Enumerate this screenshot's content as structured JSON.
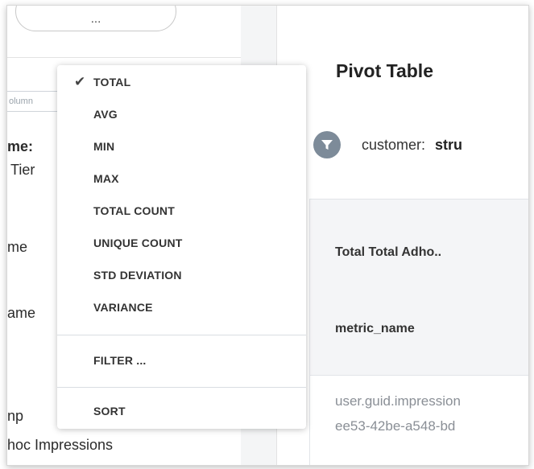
{
  "left_panel": {
    "top_pill_text": "...",
    "search_placeholder": "olumn",
    "texts": [
      "me:",
      "Tier",
      "me",
      "ame",
      "np",
      "hoc Impressions"
    ]
  },
  "right_panel": {
    "title": "Pivot Table",
    "filter": {
      "label": "customer:",
      "value": "stru"
    },
    "table": {
      "header": "Total Total Adho..",
      "subheader": "metric_name",
      "row_lines": [
        "user.guid.impression",
        "ee53-42be-a548-bd"
      ]
    }
  },
  "menu": {
    "selected_check": "✔",
    "items": [
      "TOTAL",
      "AVG",
      "MIN",
      "MAX",
      "TOTAL COUNT",
      "UNIQUE COUNT",
      "STD DEVIATION",
      "VARIANCE",
      "FILTER ...",
      "SORT"
    ]
  }
}
